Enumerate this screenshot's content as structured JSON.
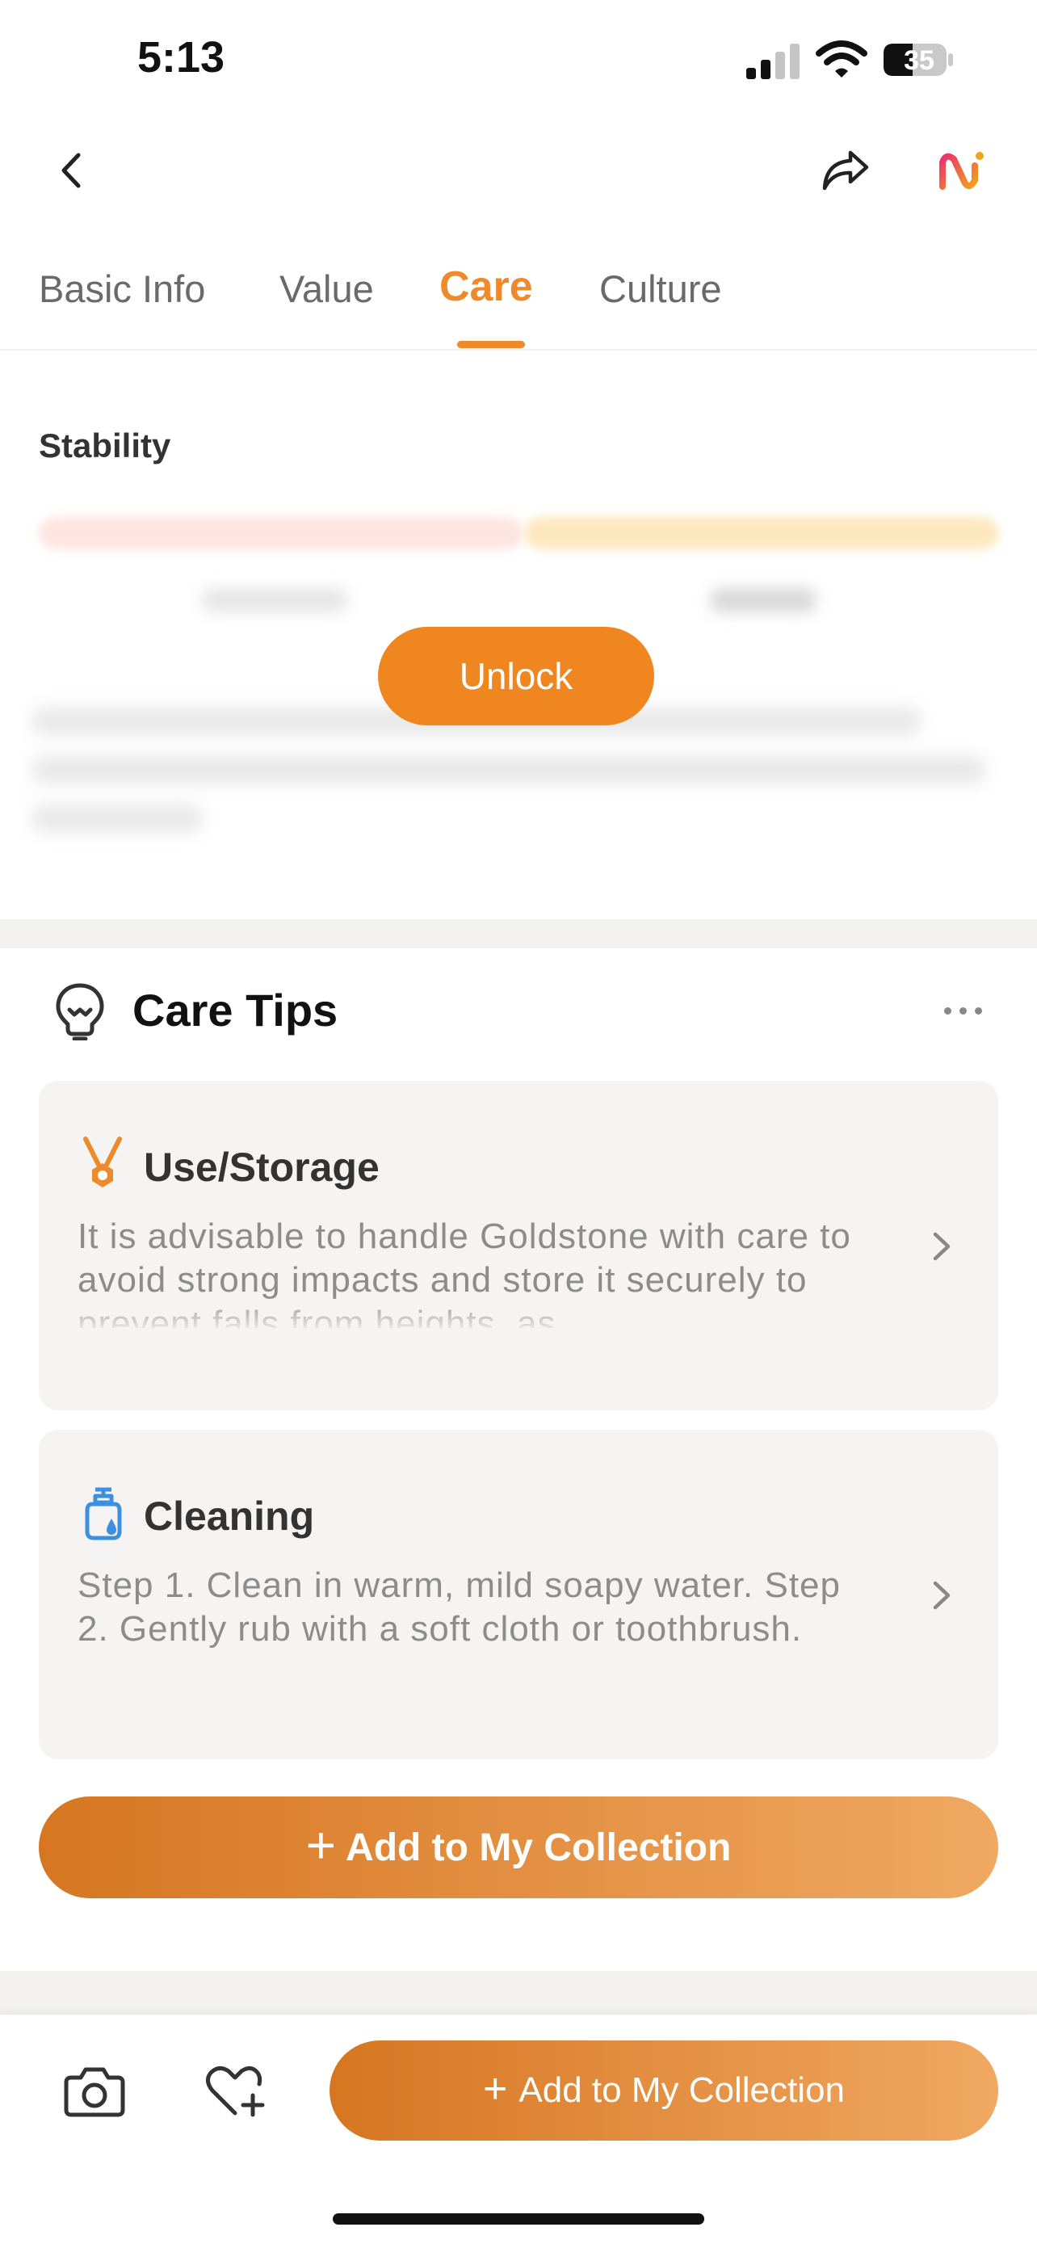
{
  "status_bar": {
    "time": "5:13",
    "battery": "35"
  },
  "tabs": [
    {
      "label": "Basic Info",
      "active": false
    },
    {
      "label": "Value",
      "active": false
    },
    {
      "label": "Care",
      "active": true
    },
    {
      "label": "Culture",
      "active": false
    }
  ],
  "stability": {
    "label": "Stability",
    "unlock_label": "Unlock"
  },
  "care_tips": {
    "title": "Care Tips",
    "cards": [
      {
        "title": "Use/Storage",
        "icon": "necklace-icon",
        "text": "It is advisable to handle Goldstone with care to avoid strong impacts and store it securely to prevent falls from heights, as"
      },
      {
        "title": "Cleaning",
        "icon": "soap-bottle-icon",
        "text": "Step 1. Clean in warm, mild soapy water. Step 2. Gently rub with a soft cloth or toothbrush."
      }
    ],
    "add_button": {
      "plus": "+",
      "label": "Add to My Collection"
    }
  },
  "bottom_bar": {
    "add_button": {
      "plus": "+",
      "label": "Add to My Collection"
    }
  },
  "colors": {
    "accent": "#ee8a2b",
    "button_gradient_start": "#d67621",
    "button_gradient_end": "#f0a862"
  }
}
